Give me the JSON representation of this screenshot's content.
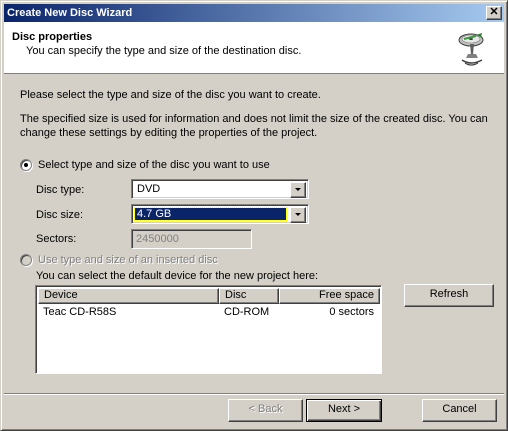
{
  "window": {
    "title": "Create New Disc Wizard",
    "close_label": "✕"
  },
  "header": {
    "title": "Disc properties",
    "subtitle": "You can specify the type and size of the destination disc.",
    "icon": "disc-wizard-icon"
  },
  "intro": "Please select the type and size of the disc you want to create.",
  "info": "The specified size is used for information and does not limit the size of the created disc. You can change these settings by editing the properties of the project.",
  "option_manual": {
    "label": "Select type and size of the disc you want to use",
    "checked": true,
    "disc_type_label": "Disc type:",
    "disc_type_value": "DVD",
    "disc_size_label": "Disc size:",
    "disc_size_value": "4.7 GB",
    "sectors_label": "Sectors:",
    "sectors_value": "2450000"
  },
  "option_inserted": {
    "label": "Use type and size of an inserted disc",
    "checked": false,
    "enabled": false
  },
  "device_hint": "You can select the default device for the new project here:",
  "device_table": {
    "columns": [
      "Device",
      "Disc",
      "Free space"
    ],
    "rows": [
      {
        "device": "Teac CD-R58S",
        "disc": "CD-ROM",
        "free_space": "0 sectors"
      }
    ]
  },
  "buttons": {
    "refresh": "Refresh",
    "back": "< Back",
    "next": "Next >",
    "cancel": "Cancel"
  },
  "colors": {
    "titlebar_start": "#0a246a",
    "titlebar_end": "#a6caf0",
    "selection": "#0a246a",
    "face": "#d4d0c8"
  }
}
